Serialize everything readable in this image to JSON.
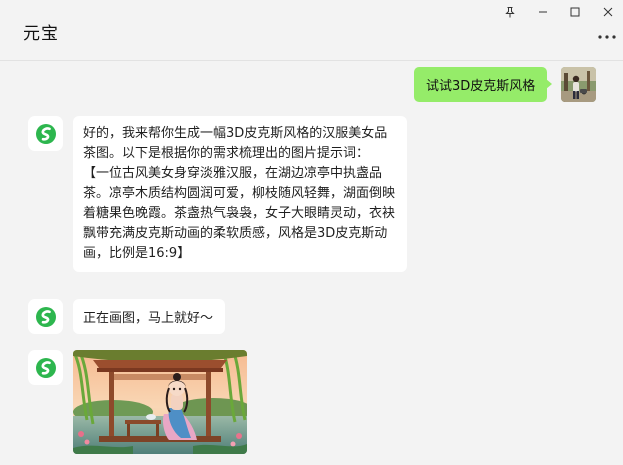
{
  "window": {
    "title": "元宝",
    "controls": {
      "pin": "pin-icon",
      "minimize": "minimize-icon",
      "maximize": "maximize-icon",
      "close": "close-icon"
    },
    "more_icon": "more-icon"
  },
  "messages": {
    "user_prompt": "试试3D皮克斯风格",
    "bot_reply_intro": "好的，我来帮你生成一幅3D皮克斯风格的汉服美女品茶图。以下是根据你的需求梳理出的图片提示词：",
    "bot_reply_prompt": "【一位古风美女身穿淡雅汉服，在湖边凉亭中执盏品茶。凉亭木质结构圆润可爱，柳枝随风轻舞，湖面倒映着糖果色晚霞。茶盏热气袅袅，女子大眼睛灵动，衣袂飘带充满皮克斯动画的柔软质感，风格是3D皮克斯动画，比例是16:9】",
    "bot_status": "正在画图，马上就好～"
  },
  "colors": {
    "background": "#f3f3f3",
    "user_bubble": "#95ec69",
    "bot_bubble": "#ffffff",
    "bot_logo": "#2db64e"
  }
}
